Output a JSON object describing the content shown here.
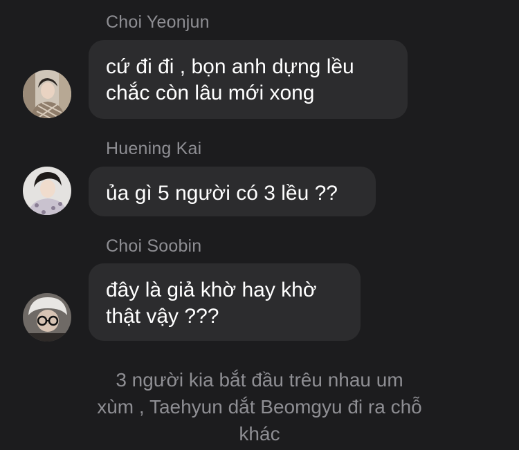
{
  "messages": [
    {
      "sender": "Choi Yeonjun",
      "avatar_icon": "user-avatar-photo",
      "lines": [
        "cứ đi đi , bọn anh dựng lều",
        "chắc còn lâu mới xong"
      ]
    },
    {
      "sender": "Huening Kai",
      "avatar_icon": "user-avatar-photo",
      "lines": [
        "ủa gì 5 người có 3 lều ??"
      ]
    },
    {
      "sender": "Choi Soobin",
      "avatar_icon": "user-avatar-photo",
      "lines": [
        "đây là giả khờ hay khờ",
        "thật vậy ???"
      ]
    }
  ],
  "system_note": {
    "lines": [
      "3 người kia bắt đầu trêu nhau um",
      "xùm , Taehyun dắt Beomgyu đi ra chỗ",
      "khác"
    ]
  },
  "colors": {
    "background": "#1c1c1e",
    "bubble": "#2c2c2e",
    "secondary_text": "#8e8e93",
    "primary_text": "#ffffff"
  }
}
